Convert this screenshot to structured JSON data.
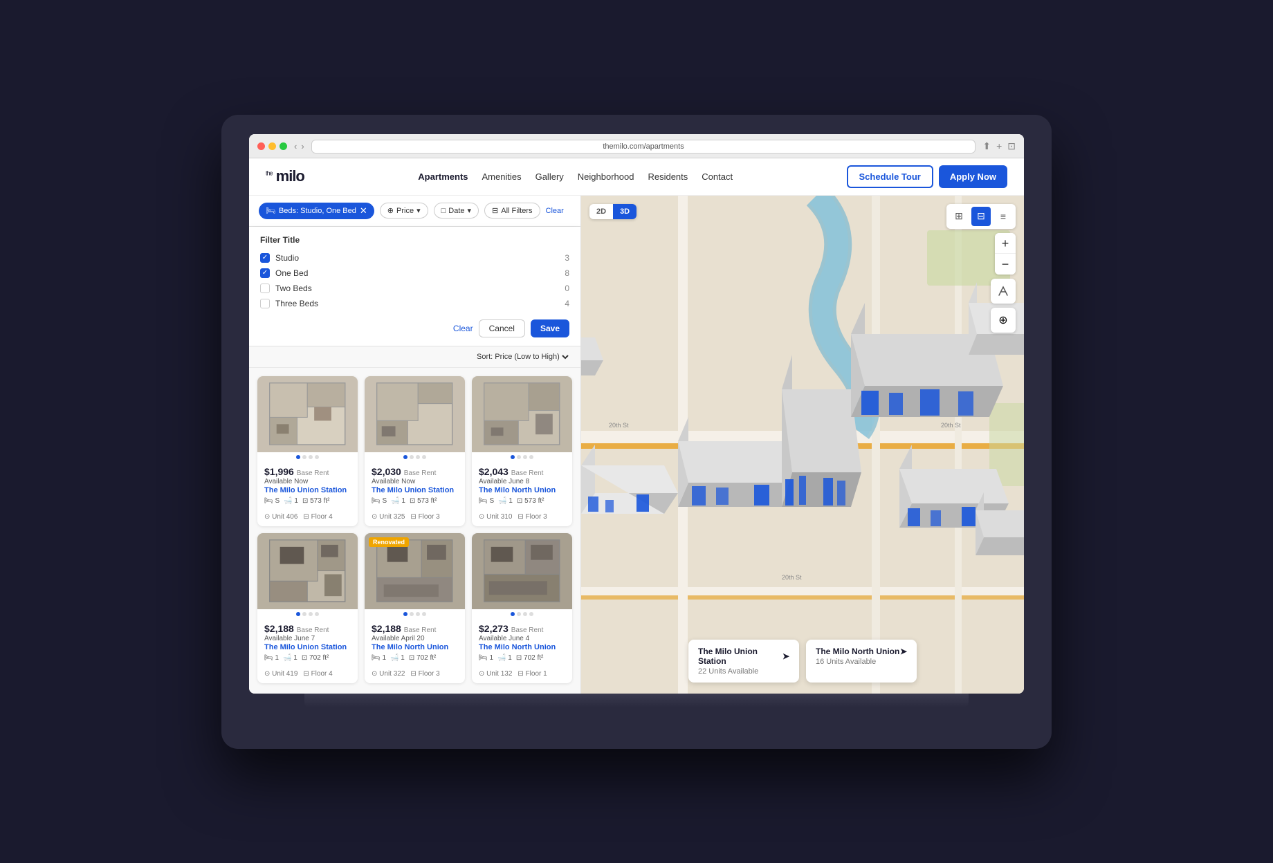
{
  "browser": {
    "url": "themilo.com/apartments",
    "nav_back": "‹",
    "nav_forward": "›"
  },
  "header": {
    "logo": "the milo",
    "nav": {
      "apartments": "Apartments",
      "amenities": "Amenities",
      "gallery": "Gallery",
      "neighborhood": "Neighborhood",
      "residents": "Residents",
      "contact": "Contact"
    },
    "schedule_tour": "Schedule Tour",
    "apply_now": "Apply Now"
  },
  "filters": {
    "active_chip": "Beds: Studio, One Bed",
    "price_label": "Price",
    "date_label": "Date",
    "all_filters_label": "All Filters",
    "clear_label": "Clear",
    "dropdown_title": "Filter Title",
    "options": [
      {
        "id": "studio",
        "label": "Studio",
        "count": "3",
        "checked": true
      },
      {
        "id": "one_bed",
        "label": "One Bed",
        "count": "8",
        "checked": true
      },
      {
        "id": "two_beds",
        "label": "Two Beds",
        "count": "0",
        "checked": false
      },
      {
        "id": "three_beds",
        "label": "Three Beds",
        "count": "4",
        "checked": false
      }
    ],
    "btn_clear": "Clear",
    "btn_cancel": "Cancel",
    "btn_save": "Save"
  },
  "sort": {
    "label": "Sort: Price (Low to High)"
  },
  "listings": [
    {
      "id": 1,
      "price": "$1,996",
      "price_label": "Base Rent",
      "availability": "Available Now",
      "building": "The Milo Union Station",
      "beds": "S",
      "baths": "1",
      "sqft": "573 ft²",
      "unit": "Unit 406",
      "floor": "Floor 4",
      "color": "#c8c0b0",
      "renovated": false
    },
    {
      "id": 2,
      "price": "$2,030",
      "price_label": "Base Rent",
      "availability": "Available Now",
      "building": "The Milo Union Station",
      "beds": "S",
      "baths": "1",
      "sqft": "573 ft²",
      "unit": "Unit 325",
      "floor": "Floor 3",
      "color": "#c8c0b0",
      "renovated": false
    },
    {
      "id": 3,
      "price": "$2,043",
      "price_label": "Base Rent",
      "availability": "Available June 8",
      "building": "The Milo North Union",
      "beds": "S",
      "baths": "1",
      "sqft": "573 ft²",
      "unit": "Unit 310",
      "floor": "Floor 3",
      "color": "#c8c0b0",
      "renovated": false
    },
    {
      "id": 4,
      "price": "$2,188",
      "price_label": "Base Rent",
      "availability": "Available June 7",
      "building": "The Milo Union Station",
      "beds": "1",
      "baths": "1",
      "sqft": "702 ft²",
      "unit": "Unit 419",
      "floor": "Floor 4",
      "color": "#b8b0a0",
      "renovated": false
    },
    {
      "id": 5,
      "price": "$2,188",
      "price_label": "Base Rent",
      "availability": "Available April 20",
      "building": "The Milo North Union",
      "beds": "1",
      "baths": "1",
      "sqft": "702 ft²",
      "unit": "Unit 322",
      "floor": "Floor 3",
      "color": "#b8b0a0",
      "renovated": true
    },
    {
      "id": 6,
      "price": "$2,273",
      "price_label": "Base Rent",
      "availability": "Available June 4",
      "building": "The Milo North Union",
      "beds": "1",
      "baths": "1",
      "sqft": "702 ft²",
      "unit": "Unit 132",
      "floor": "Floor 1",
      "color": "#b8b0a0",
      "renovated": false
    }
  ],
  "map": {
    "view_2d": "2D",
    "view_3d": "3D",
    "active_view": "3D",
    "zoom_in": "+",
    "zoom_out": "−",
    "locations": [
      {
        "name": "The Milo Union Station",
        "units": "22 Units Available"
      },
      {
        "name": "The Milo North Union",
        "units": "16 Units Available"
      }
    ]
  }
}
